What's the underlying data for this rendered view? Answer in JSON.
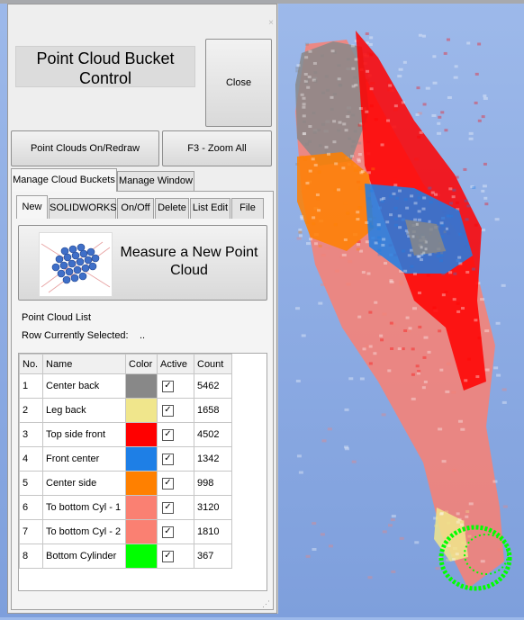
{
  "panel": {
    "title": "Point Cloud Bucket Control",
    "close_label": "Close",
    "window_close_glyph": "×",
    "redraw_label": "Point Clouds On/Redraw",
    "zoom_label": "F3 - Zoom All"
  },
  "main_tabs": [
    "Manage Cloud Buckets",
    "Manage Window"
  ],
  "sub_tabs": [
    "New",
    "SOLIDWORKS",
    "On/Off",
    "Delete",
    "List Edit",
    "File"
  ],
  "measure_button_label": "Measure a New Point Cloud",
  "list": {
    "title": "Point Cloud List",
    "row_selected_label": "Row Currently Selected:",
    "row_selected_value": "..",
    "columns": [
      "No.",
      "Name",
      "Color",
      "Active",
      "Count"
    ],
    "rows": [
      {
        "no": "1",
        "name": "Center back",
        "color": "#888888",
        "active": true,
        "count": "5462"
      },
      {
        "no": "2",
        "name": "Leg back",
        "color": "#f0e68c",
        "active": true,
        "count": "1658"
      },
      {
        "no": "3",
        "name": "Top side front",
        "color": "#ff0000",
        "active": true,
        "count": "4502"
      },
      {
        "no": "4",
        "name": "Front center",
        "color": "#1e7fe6",
        "active": true,
        "count": "1342"
      },
      {
        "no": "5",
        "name": "Center side",
        "color": "#ff8000",
        "active": true,
        "count": "998"
      },
      {
        "no": "6",
        "name": "To bottom Cyl - 1",
        "color": "#fa8072",
        "active": true,
        "count": "3120"
      },
      {
        "no": "7",
        "name": "To bottom Cyl - 2",
        "color": "#fa8072",
        "active": true,
        "count": "1810"
      },
      {
        "no": "8",
        "name": "Bottom Cylinder",
        "color": "#00ff00",
        "active": true,
        "count": "367"
      }
    ]
  },
  "icons": {
    "window_close": "close-icon",
    "measure": "point-cloud-icon",
    "checkbox": "checkbox-checked-icon",
    "resize_grip": "resize-grip-icon"
  },
  "viewport_colors": {
    "background": "#8aa9e2",
    "salmon": "#fa8072",
    "red": "#ff0000",
    "blue": "#1e7fe6",
    "orange": "#ff8000",
    "gray": "#888888",
    "khaki": "#f0e68c",
    "green": "#00ff00"
  }
}
